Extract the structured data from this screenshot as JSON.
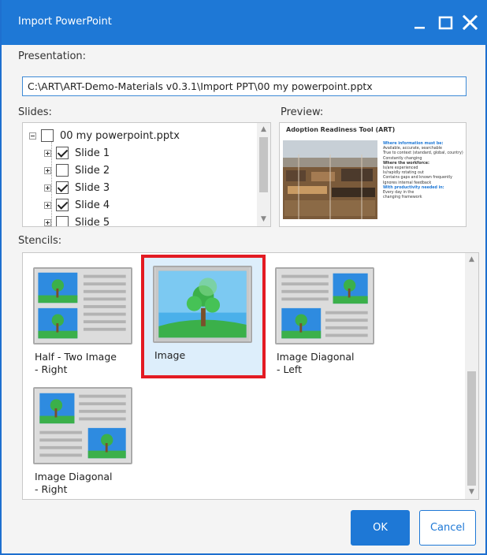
{
  "window": {
    "title": "Import PowerPoint",
    "controls": {
      "minimize": "minimize-icon",
      "maximize": "maximize-icon",
      "close": "close-icon"
    },
    "accent_color": "#1e78d6"
  },
  "presentation": {
    "label": "Presentation:",
    "path": "C:\\ART\\ART-Demo-Materials v0.3.1\\Import PPT\\00 my powerpoint.pptx"
  },
  "slides": {
    "label": "Slides:",
    "root": {
      "label": "00 my powerpoint.pptx",
      "checked": false
    },
    "items": [
      {
        "label": "Slide 1",
        "checked": true
      },
      {
        "label": "Slide 2",
        "checked": false
      },
      {
        "label": "Slide 3",
        "checked": true
      },
      {
        "label": "Slide 4",
        "checked": true
      },
      {
        "label": "Slide 5",
        "checked": false
      }
    ]
  },
  "preview": {
    "label": "Preview:",
    "slide_title": "Adoption Readiness Tool (ART)",
    "heading_1": "Where information must be:",
    "bullets_1": [
      "Available, accurate, searchable",
      "True to context (standard, global, country)",
      "Constantly changing"
    ],
    "heading_2": "Where the workforce:",
    "bullets_2": [
      "Is/are experienced",
      "Is/rapidly rotating out",
      "Contains gaps and known frequently",
      "Ignores internal feedback"
    ],
    "heading_3": "With productivity needed in:",
    "bullets_3": [
      "Every day in the",
      "changing framework"
    ]
  },
  "stencils": {
    "label": "Stencils:",
    "items": [
      {
        "name": "Half - Two Image - Right",
        "line1": "Half - Two Image",
        "line2": "- Right"
      },
      {
        "name": "Image",
        "line1": "Image",
        "line2": ""
      },
      {
        "name": "Image Diagonal - Left",
        "line1": "Image Diagonal",
        "line2": "- Left"
      },
      {
        "name": "Image Diagonal - Right",
        "line1": "Image Diagonal",
        "line2": "- Right"
      }
    ],
    "selected": "Image",
    "selection_color": "#e31b23"
  },
  "buttons": {
    "ok": "OK",
    "cancel": "Cancel"
  }
}
